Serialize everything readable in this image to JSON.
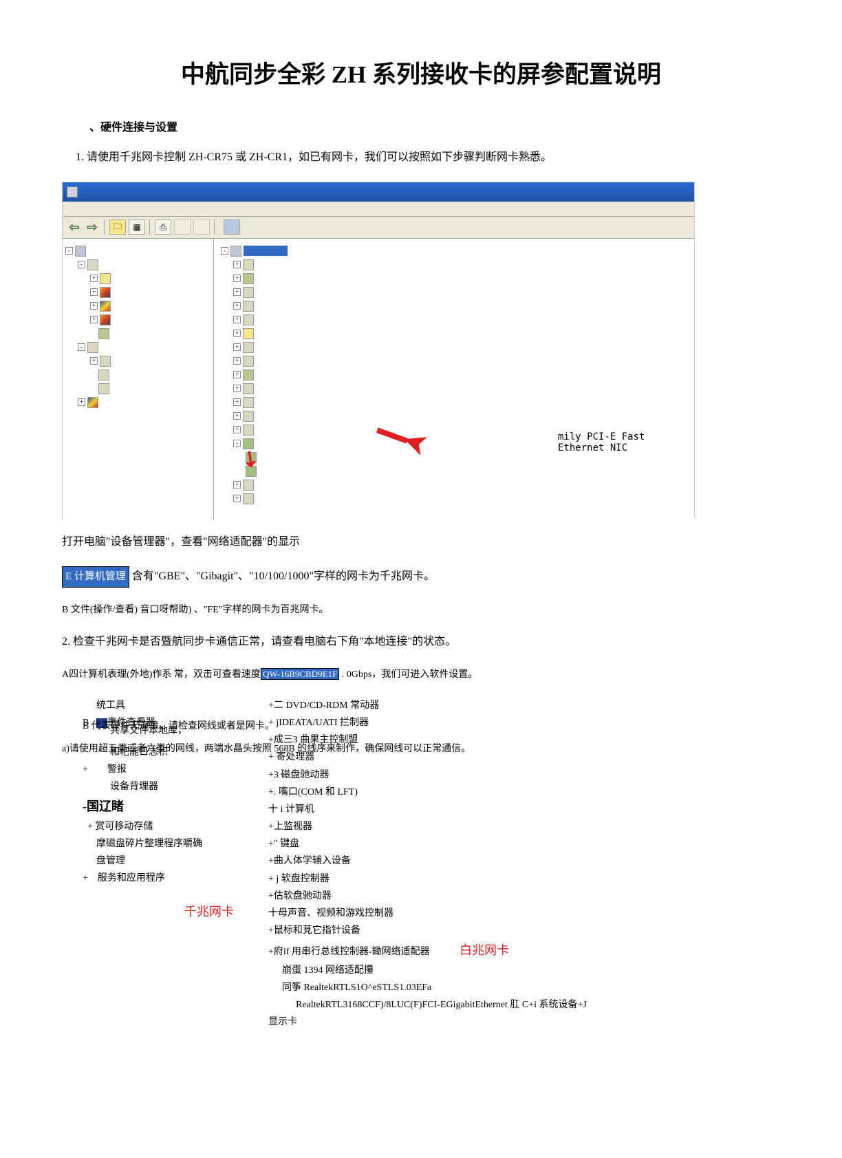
{
  "doc": {
    "title": "中航同步全彩 ZH 系列接收卡的屏参配置说明",
    "section_label": "、硬件连接与设置",
    "item1": "1.    请使用千兆网卡控制 ZH-CR75 或 ZH-CR1，如已有网卡，我们可以按照如下步骤判断网卡熟悉。",
    "after_ss_line": "打开电脑\"设备管理器\"，查看\"网络适配器\"的显示",
    "overlap_line1_prefix": "",
    "overlap_line1_suffix": "含有\"GBE\"、\"Gibagit\"、\"10/100/1000\"字样的网卡为千兆网卡。",
    "cm_label": "E 计算机管理",
    "overlap_line2": "B 文件(操作/查看) 音口呀帮助)  、\"FE\"字样的网卡为百兆网卡。",
    "item2": "2.  检查千兆网卡是否暨航同步卡通信正常，请查看电脑右下角\"本地连接\"的状态。",
    "line_A_pre": "A四计算机表理(外地)作系 常，双击可查看速度",
    "selected_code": "QW-16B9CBD9E1F",
    "line_A_post": " . 0Gbps，我们可进入软件设置。",
    "line_B": "B       代表硬件无连接，请检查网线或者是网卡。",
    "line_a1": "a)请使用超五类或者六类的网线，两端水晶头按照 568B 的线序来制作，确保网线可以正常通信。"
  },
  "screenshot": {
    "ethernet_nic": "mily PCI-E Fast Ethernet NIC"
  },
  "devtree_left": {
    "l0": "统工具",
    "l1_icon_text": "事件查看器",
    "l2": "共享文件本地库，",
    "l3": "和粑能日志积",
    "l4": "警报",
    "l5": "设备背理器",
    "h1": "-国辽睹",
    "r1": "赏可移动存储",
    "r2": "摩磁盘碎片整理程序嚼确",
    "r3": "盘管理",
    "r4": "服务和应用程序",
    "ann_qz": "千兆网卡"
  },
  "devtree_right": {
    "r0": "+二 DVD/CD-RDM 常动器",
    "r1": "+ jIDEATA/UATI 拦制器",
    "r2": "+成三3 曲果主控制盟",
    "r3": "+ 寄处理器",
    "r4": "+3 磁盘驰动器",
    "r5": "+. 嘴口(COM 和 LFT)",
    "r6": "十 i 计算机",
    "r7": "+上监视器",
    "r8": "+\" 键盘",
    "r9": "+曲人体学辅入设备",
    "r10": "+ j 软盘控制器",
    "r11": "+估软盘驰动器",
    "r12": "十母声音、视频和游戏控制器",
    "r13": "+鼠标和莧它指针设备",
    "r14_a": "+府if 用串行总线控制器-鋤网络适配器",
    "ann_bz": "白兆网卡",
    "r15": "崩蛋 1394 网络适配攥",
    "r16": "同筝 RealtekRTLS1O^eSTLS1.03EFa",
    "r17": "RealtekRTL3168CCF)/8LUC(F)FCI-EGigabitEthernet 肛 C+i 系统设备+J",
    "r18": "显示卡"
  }
}
